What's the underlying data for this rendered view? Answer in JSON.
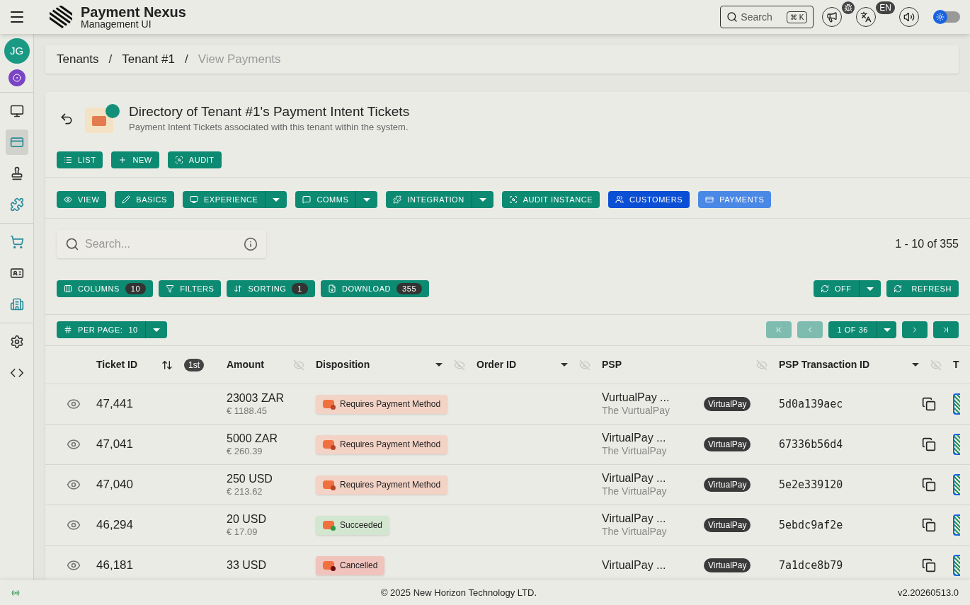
{
  "header": {
    "app_title": "Payment Nexus",
    "app_subtitle": "Management UI",
    "search": {
      "placeholder": "Search",
      "shortcut": "⌘ K"
    },
    "language_badge": "EN",
    "theme_switch": {
      "on": false
    }
  },
  "sidebar": {
    "avatar": "JG",
    "items": [
      {
        "selected": false
      },
      {
        "selected": true
      },
      {
        "selected": false
      },
      {
        "selected": false
      },
      {
        "selected": false
      },
      {
        "selected": false
      },
      {
        "selected": false
      },
      {
        "selected": false
      },
      {
        "selected": false
      }
    ]
  },
  "breadcrumb": [
    {
      "label": "Tenants",
      "current": false
    },
    {
      "separator": "/",
      "label": "Tenant #1",
      "current": false
    },
    {
      "separator": "/",
      "label": "View Payments",
      "current": true
    }
  ],
  "page": {
    "title": "Directory of Tenant #1's Payment Intent Tickets",
    "subtitle": "Payment Intent Tickets associated with this tenant within the system."
  },
  "actions": [
    {
      "label": "LIST"
    },
    {
      "label": "NEW"
    },
    {
      "label": "AUDIT"
    }
  ],
  "tabs": [
    {
      "label": "VIEW",
      "kind": "plain",
      "split": false
    },
    {
      "label": "BASICS",
      "kind": "plain",
      "split": false
    },
    {
      "label": "EXPERIENCE",
      "kind": "plain",
      "split": true
    },
    {
      "label": "COMMS",
      "kind": "plain",
      "split": true
    },
    {
      "label": "INTEGRATION",
      "kind": "plain",
      "split": true
    },
    {
      "label": "AUDIT INSTANCE",
      "kind": "plain",
      "split": false
    },
    {
      "label": "CUSTOMERS",
      "kind": "colored",
      "split": false,
      "color": "#0b4fd4"
    },
    {
      "label": "PAYMENTS",
      "kind": "colored",
      "split": false,
      "color": "#4a88e6"
    }
  ],
  "search": {
    "placeholder": "Search..."
  },
  "range": "1 - 10 of 355",
  "tools": [
    {
      "label": "COLUMNS",
      "count": "10"
    },
    {
      "label": "FILTERS"
    },
    {
      "label": "SORTING",
      "count": "1"
    },
    {
      "label": "DOWNLOAD",
      "count": "355"
    }
  ],
  "auto_refresh": {
    "label": "OFF"
  },
  "refresh": {
    "label": "REFRESH"
  },
  "per_page": {
    "label": "PER PAGE:",
    "value": "10"
  },
  "pagination": {
    "first": {
      "disabled": true
    },
    "prev": {
      "disabled": true
    },
    "page": "1 OF 36",
    "next": {
      "disabled": false
    },
    "last": {
      "disabled": false
    }
  },
  "table": {
    "columns": [
      {
        "label": "Ticket ID",
        "sort_rank": "1st",
        "dropdown": false,
        "hideable": false
      },
      {
        "label": "Amount",
        "dropdown": false,
        "hideable": true
      },
      {
        "label": "Disposition",
        "dropdown": true,
        "hideable": true
      },
      {
        "label": "Order ID",
        "dropdown": true,
        "hideable": true
      },
      {
        "label": "PSP",
        "dropdown": false,
        "hideable": true
      },
      {
        "label": "PSP Transaction ID",
        "dropdown": true,
        "hideable": true
      },
      {
        "label": "T",
        "dropdown": false,
        "hideable": false
      }
    ],
    "rows": [
      {
        "ticket_id": "47,441",
        "amount": "23003 ZAR",
        "amount_eur": "€ 1188.45",
        "disposition": "Requires Payment Method",
        "kind": "pending",
        "psp_name": "VurtualPay ...",
        "psp_sub": "The VurtualPay",
        "psp_tag": "VirtualPay",
        "psp_tx": "5d0a139aec"
      },
      {
        "ticket_id": "47,041",
        "amount": "5000 ZAR",
        "amount_eur": "€ 260.39",
        "disposition": "Requires Payment Method",
        "kind": "pending",
        "psp_name": "VirtualPay ...",
        "psp_sub": "The VirtualPay",
        "psp_tag": "VirtualPay",
        "psp_tx": "67336b56d4"
      },
      {
        "ticket_id": "47,040",
        "amount": "250 USD",
        "amount_eur": "€ 213.62",
        "disposition": "Requires Payment Method",
        "kind": "pending",
        "psp_name": "VirtualPay ...",
        "psp_sub": "The VirtualPay",
        "psp_tag": "VirtualPay",
        "psp_tx": "5e2e339120"
      },
      {
        "ticket_id": "46,294",
        "amount": "20 USD",
        "amount_eur": "€ 17.09",
        "disposition": "Succeeded",
        "kind": "succeeded",
        "psp_name": "VirtualPay ...",
        "psp_sub": "The VirtualPay",
        "psp_tag": "VirtualPay",
        "psp_tx": "5ebdc9af2e"
      },
      {
        "ticket_id": "46,181",
        "amount": "33 USD",
        "disposition": "Cancelled",
        "kind": "cancelled",
        "psp_name": "VirtualPay ...",
        "psp_tag": "VirtualPay",
        "psp_tx": "7a1dce8b79"
      }
    ]
  },
  "footer": {
    "copyright": "© 2025 New Horizon Technology LTD.",
    "version": "v2.20260513.0"
  }
}
